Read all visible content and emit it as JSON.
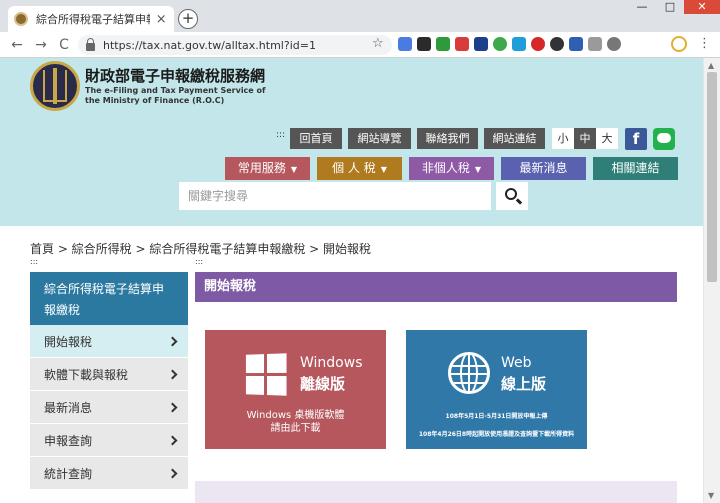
{
  "browser": {
    "tab_title": "綜合所得稅電子結算申報繳稅-開",
    "tab_close": "×",
    "new_tab": "+",
    "url": "https://tax.nat.gov.tw/alltax.html?id=1",
    "back": "←",
    "forward": "→",
    "reload": "C",
    "star": "☆",
    "menu": "⋮",
    "window_controls": [
      "—",
      "□",
      "✕"
    ],
    "scroll_up": "▲",
    "scroll_down": "▼"
  },
  "header": {
    "title": "財政部電子申報繳稅服務網",
    "subtitle": "The e-Filing and Tax Payment Service of the Ministry of Finance (R.O.C)",
    "util_dots": ":::",
    "util_links": [
      "回首頁",
      "網站導覽",
      "聯絡我們",
      "網站連結"
    ],
    "font_sizes": [
      "小",
      "中",
      "大"
    ],
    "facebook_label": "f",
    "main_nav": [
      {
        "label": "常用服務",
        "caret": "▼",
        "color": "#b5575d"
      },
      {
        "label": "個 人 稅",
        "caret": "▼",
        "color": "#b07a1f"
      },
      {
        "label": "非個人稅",
        "caret": "▼",
        "color": "#8e5aa6"
      },
      {
        "label": "最新消息",
        "caret": "",
        "color": "#5a62b0"
      },
      {
        "label": "相關連結",
        "caret": "",
        "color": "#2f7f78"
      }
    ],
    "search_placeholder": "關鍵字搜尋"
  },
  "breadcrumb": "首頁 > 綜合所得稅 > 綜合所得稅電子結算申報繳稅 > 開始報稅",
  "dots": ":::",
  "sidebar": {
    "heading": "綜合所得稅電子結算申報繳稅",
    "items": [
      "開始報稅",
      "軟體下載與報稅",
      "最新消息",
      "申報查詢",
      "統計查詢"
    ]
  },
  "content": {
    "title": "開始報稅",
    "cards": {
      "windows": {
        "name": "Windows",
        "sub": "離線版",
        "desc_line1": "Windows 桌機版軟體",
        "desc_line2": "請由此下載"
      },
      "web": {
        "name": "Web",
        "sub": "線上版",
        "note_line1": "108年5月1日-5月31日開放申報上傳",
        "note_line2": "108年4月26日8時起開放使用憑證及查詢暨下載所得資料"
      }
    }
  },
  "colors": {
    "header_bg": "#c2e6ea",
    "sidebar_head": "#2b79a1",
    "content_title": "#7d5aa3",
    "windows_card": "#b5575d",
    "web_card": "#2f78a8"
  }
}
